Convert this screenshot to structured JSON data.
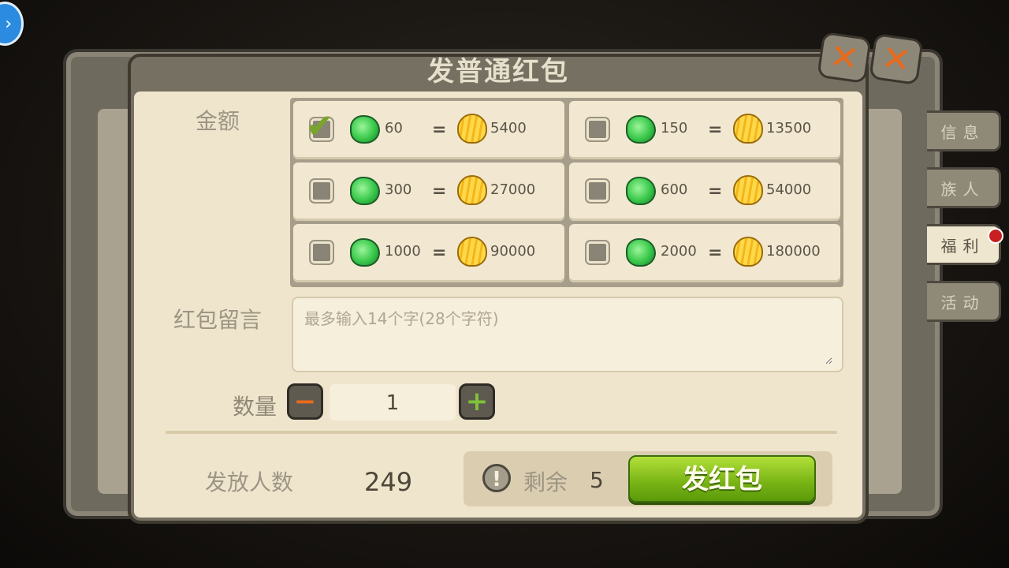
{
  "dialog": {
    "title": "发普通红包"
  },
  "amount_section": {
    "label": "金额",
    "options": [
      {
        "gems": "60",
        "equals": "=",
        "shells": "5400",
        "selected": true
      },
      {
        "gems": "150",
        "equals": "=",
        "shells": "13500",
        "selected": false
      },
      {
        "gems": "300",
        "equals": "=",
        "shells": "27000",
        "selected": false
      },
      {
        "gems": "600",
        "equals": "=",
        "shells": "54000",
        "selected": false
      },
      {
        "gems": "1000",
        "equals": "=",
        "shells": "90000",
        "selected": false
      },
      {
        "gems": "2000",
        "equals": "=",
        "shells": "180000",
        "selected": false
      }
    ]
  },
  "message": {
    "label": "红包留言",
    "placeholder": "最多输入14个字(28个字符)"
  },
  "quantity": {
    "label": "数量",
    "value": "1"
  },
  "recipients": {
    "label": "发放人数",
    "value": "249"
  },
  "remaining": {
    "label": "剩余",
    "value": "5"
  },
  "send_button": {
    "label": "发红包"
  },
  "side_tabs": [
    {
      "label": "信息",
      "active": false
    },
    {
      "label": "族人",
      "active": false
    },
    {
      "label": "福利",
      "active": true
    },
    {
      "label": "活动",
      "active": false
    }
  ],
  "colors": {
    "accent_green": "#77b214",
    "panel": "#efe5cc",
    "close_orange": "#e86b1e"
  }
}
